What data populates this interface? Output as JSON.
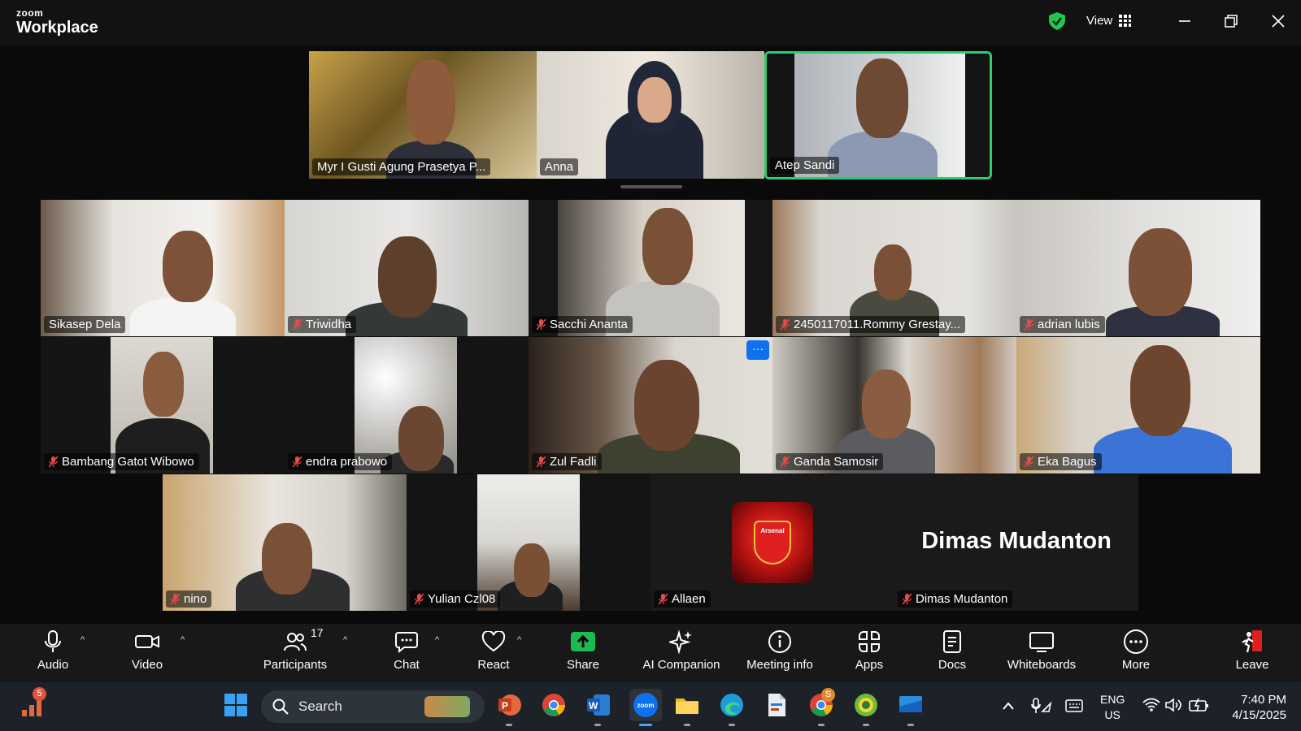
{
  "app": {
    "logo_top": "zoom",
    "logo_bottom": "Workplace",
    "view_label": "View"
  },
  "top_strip": [
    {
      "name": "Myr I Gusti Agung Prasetya P...",
      "active": false
    },
    {
      "name": "Anna",
      "active": false
    },
    {
      "name": "Atep Sandi",
      "active": true
    }
  ],
  "gallery": {
    "row1": [
      {
        "name": "Sikasep Dela",
        "muted": false
      },
      {
        "name": "Triwidha",
        "muted": true
      },
      {
        "name": "Sacchi Ananta",
        "muted": true
      },
      {
        "name": "2450117011.Rommy Grestay...",
        "muted": true
      },
      {
        "name": "adrian lubis",
        "muted": true
      }
    ],
    "row2": [
      {
        "name": "Bambang Gatot Wibowo",
        "muted": true
      },
      {
        "name": "endra prabowo",
        "muted": true
      },
      {
        "name": "Zul Fadli",
        "muted": true
      },
      {
        "name": "Ganda Samosir",
        "muted": true
      },
      {
        "name": "Eka Bagus",
        "muted": true
      }
    ],
    "row3": [
      {
        "name": "nino",
        "muted": true
      },
      {
        "name": "Yulian Czl08",
        "muted": true
      },
      {
        "name": "Allaen",
        "muted": true
      },
      {
        "name": "Dimas Mudanton",
        "muted": true
      }
    ],
    "dimas_display_name": "Dimas Mudanton",
    "allaen_avatar_text": "Arsenal",
    "more_options": "···"
  },
  "toolbar": {
    "audio": "Audio",
    "video": "Video",
    "participants": "Participants",
    "participants_count": "17",
    "chat": "Chat",
    "react": "React",
    "share": "Share",
    "ai_companion": "AI Companion",
    "meeting_info": "Meeting info",
    "apps": "Apps",
    "docs": "Docs",
    "whiteboards": "Whiteboards",
    "more": "More",
    "leave": "Leave"
  },
  "taskbar": {
    "search_placeholder": "Search",
    "start_badge": "5",
    "chrome_badge": "S",
    "lang_top": "ENG",
    "lang_bottom": "US",
    "time": "7:40 PM",
    "date": "4/15/2025",
    "zoom_icon_text": "zoom"
  },
  "colors": {
    "active_speaker": "#2ecc71",
    "share_green": "#1db954",
    "muted_red": "#e64b4b",
    "zoom_blue": "#0e72ed"
  }
}
